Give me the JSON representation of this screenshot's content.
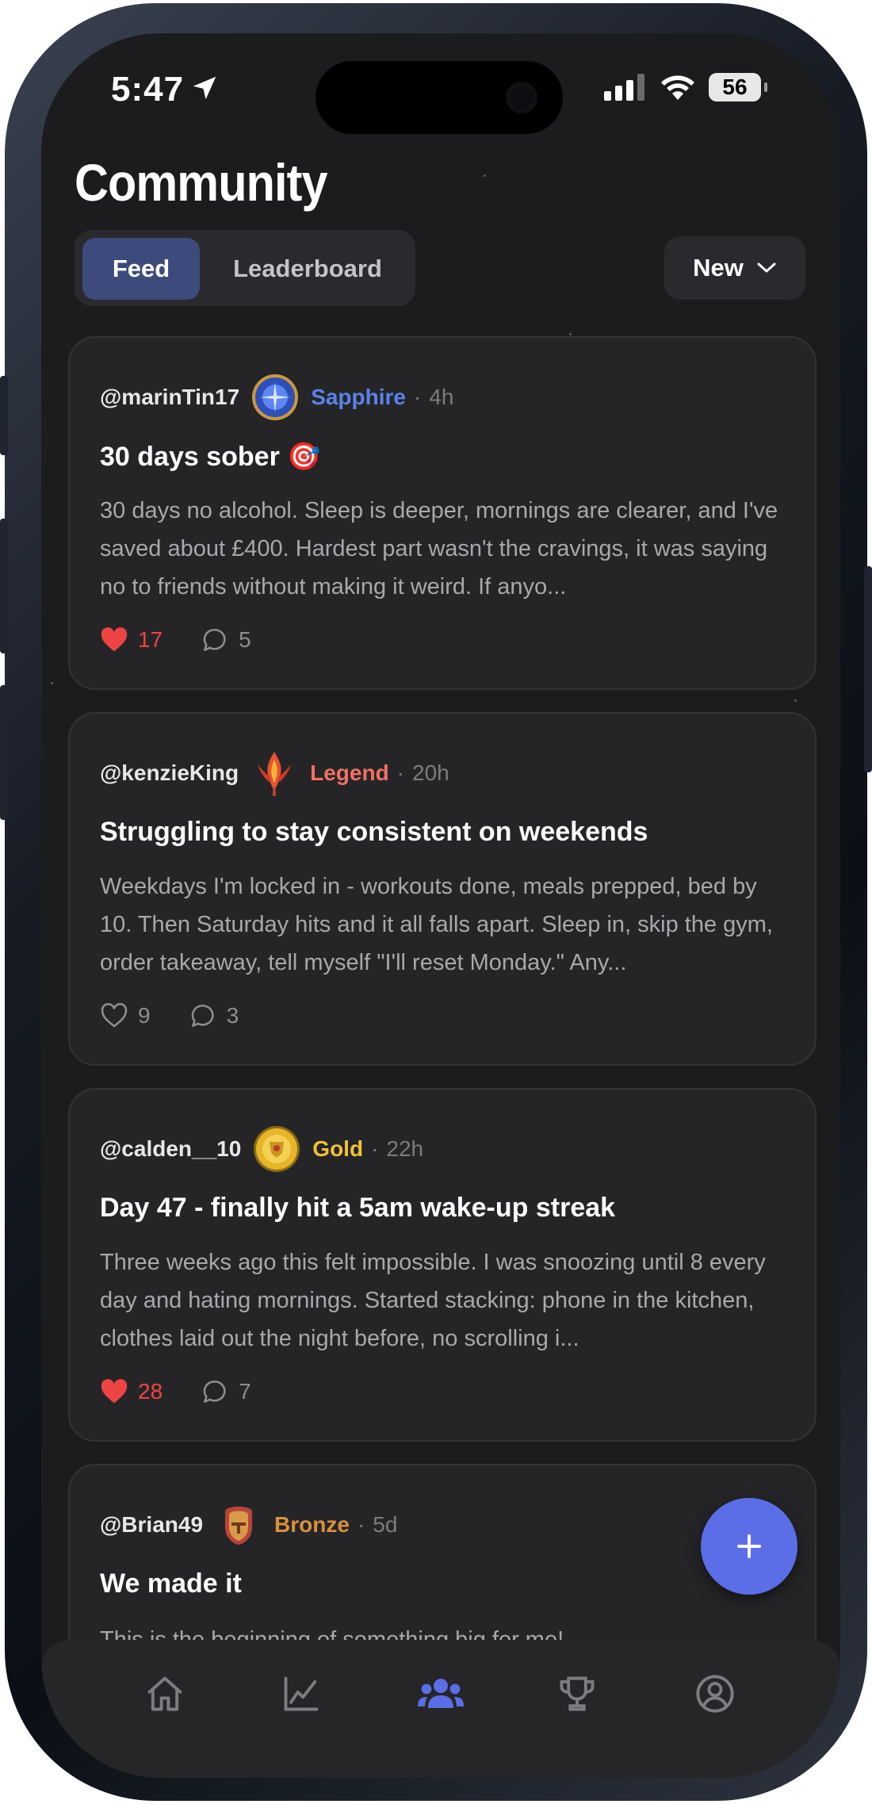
{
  "status_bar": {
    "time": "5:47",
    "battery": "56"
  },
  "header": {
    "title": "Community"
  },
  "segmented": {
    "feed_label": "Feed",
    "leaderboard_label": "Leaderboard",
    "active": "Feed"
  },
  "sort": {
    "label": "New"
  },
  "posts": [
    {
      "handle": "@marinTin17",
      "tier": "Sapphire",
      "tier_color": "#5b82e8",
      "age": "4h",
      "title": "30 days sober 🎯",
      "body": "30 days no alcohol. Sleep is deeper, mornings are clearer, and I've saved about £400. Hardest part wasn't the cravings, it was saying no to friends without making it weird. If anyo...",
      "likes": "17",
      "liked": true,
      "comments": "5"
    },
    {
      "handle": "@kenzieKing",
      "tier": "Legend",
      "tier_color": "#f07063",
      "age": "20h",
      "title": "Struggling to stay consistent on weekends",
      "body": "Weekdays I'm locked in - workouts done, meals prepped, bed by 10. Then Saturday hits and it all falls apart. Sleep in, skip the gym, order takeaway, tell myself \"I'll reset Monday.\" Any...",
      "likes": "9",
      "liked": false,
      "comments": "3"
    },
    {
      "handle": "@calden__10",
      "tier": "Gold",
      "tier_color": "#f0c230",
      "age": "22h",
      "title": "Day 47 - finally hit a 5am wake-up streak",
      "body": "Three weeks ago this felt impossible. I was snoozing until 8 every day and hating mornings. Started stacking: phone in the kitchen, clothes laid out the night before, no scrolling i...",
      "likes": "28",
      "liked": true,
      "comments": "7"
    },
    {
      "handle": "@Brian49",
      "tier": "Bronze",
      "tier_color": "#d9913a",
      "age": "5d",
      "title": "We made it",
      "body": "This is the beginning of something big for me!"
    }
  ],
  "colors": {
    "accent": "#5b6ee8",
    "background": "#1c1c1e",
    "card": "#252527",
    "like": "#ef4444"
  },
  "tabbar": {
    "items": [
      "home-icon",
      "chart-icon",
      "community-icon",
      "trophy-icon",
      "profile-icon"
    ],
    "active": "community-icon"
  }
}
